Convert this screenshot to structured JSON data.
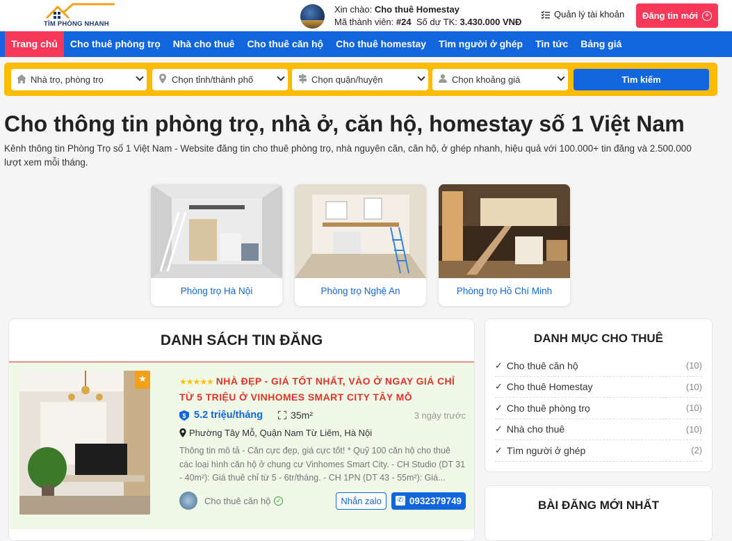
{
  "header": {
    "logo_text": "TÌM PHÒNG NHANH",
    "greeting_label": "Xin chào:",
    "user_name": "Cho thuê Homestay",
    "member_label": "Mã thành viên:",
    "member_id": "#24",
    "balance_label": "Số dư TK:",
    "balance": "3.430.000 VNĐ",
    "manage_label": "Quản lý tài khoản",
    "post_label": "Đăng tin mới"
  },
  "nav": {
    "items": [
      "Trang chủ",
      "Cho thuê phòng trọ",
      "Nhà cho thuê",
      "Cho thuê căn hộ",
      "Cho thuê homestay",
      "Tìm người ở ghép",
      "Tin tức",
      "Bảng giá"
    ]
  },
  "search": {
    "type": "Nhà trọ, phòng trọ",
    "city": "Chọn tỉnh/thành phố",
    "district": "Chọn quận/huyện",
    "price": "Chọn khoảng giá",
    "button": "Tìm kiếm"
  },
  "hero": {
    "title": "Cho thông tin phòng trọ, nhà ở, căn hộ, homestay số 1 Việt Nam",
    "intro": "Kênh thông tin Phòng Trọ số 1 Việt Nam - Website đăng tin cho thuê phòng trọ, nhà nguyên căn, căn hộ, ở ghép nhanh, hiệu quả với 100.000+ tin đăng và 2.500.000 lượt xem mỗi tháng."
  },
  "cities": [
    "Phòng trọ Hà Nội",
    "Phòng trọ Nghệ An",
    "Phòng trọ Hồ Chí Minh"
  ],
  "listings": {
    "title": "DANH SÁCH TIN ĐĂNG",
    "item": {
      "stars": "★★★★★",
      "title": "NHÀ ĐẸP - GIÁ TỐT NHẤT, VÀO Ở NGAY GIÁ CHỈ TỪ 5 TRIỆU Ở VINHOMES SMART CITY TÂY MỖ",
      "price": "5.2 triệu/tháng",
      "area": "35m²",
      "time": "3 ngày trước",
      "address": "Phường Tây Mỗ, Quận Nam Từ Liêm, Hà Nội",
      "description": "Thông tin mô tả - Căn cực đẹp, giá cực tốt! * Quỹ 100 căn hộ cho thuê các loại hình căn hộ ở chung cư Vinhomes Smart City. - CH Studio (DT 31 - 40m²): Giá thuê chỉ từ 5 - 6tr/tháng. - CH 1PN (DT 43 - 55m²): Giá...",
      "category": "Cho thuê căn hộ",
      "zalo": "Nhắn zalo",
      "phone": "0932379749"
    }
  },
  "categories": {
    "title": "DANH MỤC CHO THUÊ",
    "items": [
      {
        "label": "Cho thuê căn hộ",
        "count": "(10)"
      },
      {
        "label": "Cho thuê Homestay",
        "count": "(10)"
      },
      {
        "label": "Cho thuê phòng trọ",
        "count": "(10)"
      },
      {
        "label": "Nhà cho thuê",
        "count": "(10)"
      },
      {
        "label": "Tìm người ở ghép",
        "count": "(2)"
      }
    ]
  },
  "latest": {
    "title": "BÀI ĐĂNG MỚI NHẤT"
  },
  "colors": {
    "primary": "#1266dd",
    "accent": "#f73859",
    "search_bg": "#febb02",
    "title_red": "#e13427"
  }
}
